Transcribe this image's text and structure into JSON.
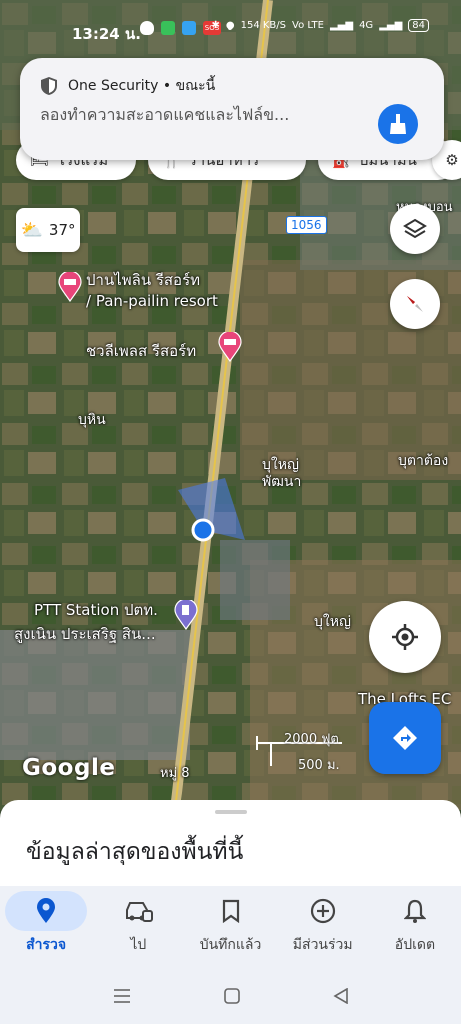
{
  "status_bar": {
    "time": "13:24 น.",
    "net_speed": "154 KB/S",
    "net_type": "Vo LTE",
    "signal_label": "4G",
    "battery": "84"
  },
  "notification": {
    "app_name": "One Security • ขณะนี้",
    "message": "ลองทำความสะอาดแคชและไฟล์ข..."
  },
  "chips": [
    "โรงแรม",
    "ร้านอาหาร",
    "ปั๊มน้ำมัน"
  ],
  "weather": {
    "temp": "37°"
  },
  "map_labels": {
    "route_shield": "1056",
    "pan_pailin_1": "ปานไพลิน รีสอร์ท",
    "pan_pailin_2": "/ Pan-pailin resort",
    "chalee_place": "ชวลีเพลส รีสอร์ท",
    "buhin": "บุหิน",
    "buyai_1": "บุใหญ่",
    "buyai_2": "พัฒนา",
    "butatong": "บุตาต้อง",
    "nongbon_1": "หนองบอน",
    "nongbon_2": "พ",
    "ptt_1": "PTT Station ปตท.",
    "ptt_2": "สูงเนิน ประเสริฐ สิน...",
    "buyai_south": "บุใหญ่",
    "the_lofts": "The Lofts EC",
    "moo8": "หมู่ 8",
    "google": "Google",
    "scale_ft": "2000 ฟุต",
    "scale_m": "500 ม."
  },
  "bottom_sheet": {
    "title": "ข้อมูลล่าสุดของพื้นที่นี้"
  },
  "nav": [
    {
      "label": "สำรวจ",
      "icon": "location-pin-icon"
    },
    {
      "label": "ไป",
      "icon": "car-icon"
    },
    {
      "label": "บันทึกแล้ว",
      "icon": "bookmark-icon"
    },
    {
      "label": "มีส่วนร่วม",
      "icon": "add-circle-icon"
    },
    {
      "label": "อัปเดต",
      "icon": "bell-icon"
    }
  ],
  "colors": {
    "accent": "#1a73e8",
    "nav_active": "#0b57d0",
    "pin_pink": "#e8457a"
  }
}
